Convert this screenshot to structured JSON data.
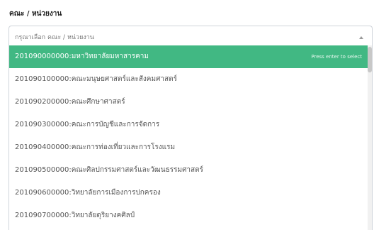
{
  "field": {
    "label": "คณะ / หน่วยงาน"
  },
  "select": {
    "placeholder": "กรุณาเลือก คณะ / หน่วยงาน",
    "caret_icon": "chevron-up-icon"
  },
  "dropdown": {
    "hint": "Press enter to select",
    "options": [
      "201090000000:มหาวิทยาลัยมหาสารคาม",
      "201090100000:คณะมนุษยศาสตร์และสังคมศาสตร์",
      "201090200000:คณะศึกษาศาสตร์",
      "201090300000:คณะการบัญชีและการจัดการ",
      "201090400000:คณะการท่องเที่ยวและการโรงแรม",
      "201090500000:คณะศิลปกรรมศาสตร์และวัฒนธรรมศาสตร์",
      "201090600000:วิทยาลัยการเมืองการปกครอง",
      "201090700000:วิทยาลัยดุริยางคศิลป์"
    ]
  },
  "colors": {
    "selected_bg": "#41b883"
  }
}
